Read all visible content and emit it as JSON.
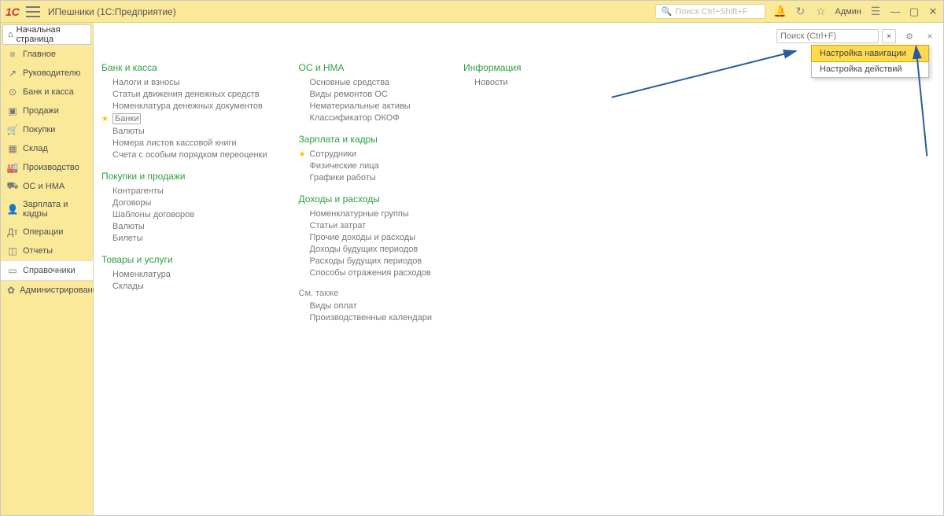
{
  "titlebar": {
    "app_title": "ИПешники  (1С:Предприятие)",
    "search_placeholder": "Поиск Ctrl+Shift+F",
    "user_label": "Админ"
  },
  "home_tab": {
    "label": "Начальная страница"
  },
  "sidebar": {
    "items": [
      {
        "icon": "≡",
        "label": "Главное"
      },
      {
        "icon": "↗",
        "label": "Руководителю"
      },
      {
        "icon": "⊙",
        "label": "Банк и касса"
      },
      {
        "icon": "▣",
        "label": "Продажи"
      },
      {
        "icon": "🛒",
        "label": "Покупки"
      },
      {
        "icon": "▦",
        "label": "Склад"
      },
      {
        "icon": "🏭",
        "label": "Производство"
      },
      {
        "icon": "⛟",
        "label": "ОС и НМА"
      },
      {
        "icon": "👤",
        "label": "Зарплата и кадры"
      },
      {
        "icon": "Дт",
        "label": "Операции"
      },
      {
        "icon": "◫",
        "label": "Отчеты"
      },
      {
        "icon": "▭",
        "label": "Справочники"
      },
      {
        "icon": "✿",
        "label": "Администрирование"
      }
    ],
    "selected_index": 11
  },
  "panel": {
    "search_placeholder": "Поиск (Ctrl+F)",
    "dropdown": {
      "items": [
        "Настройка навигации",
        "Настройка действий"
      ],
      "highlighted_index": 0
    }
  },
  "columns": [
    {
      "groups": [
        {
          "title": "Банк и касса",
          "links": [
            {
              "text": "Налоги и взносы"
            },
            {
              "text": "Статьи движения денежных средств"
            },
            {
              "text": "Номенклатура денежных документов"
            },
            {
              "text": "Банки",
              "starred": true,
              "boxed": true
            },
            {
              "text": "Валюты"
            },
            {
              "text": "Номера листов кассовой книги"
            },
            {
              "text": "Счета с особым порядком переоценки"
            }
          ]
        },
        {
          "title": "Покупки и продажи",
          "links": [
            {
              "text": "Контрагенты"
            },
            {
              "text": "Договоры"
            },
            {
              "text": "Шаблоны договоров"
            },
            {
              "text": "Валюты"
            },
            {
              "text": "Билеты"
            }
          ]
        },
        {
          "title": "Товары и услуги",
          "links": [
            {
              "text": "Номенклатура"
            },
            {
              "text": "Склады"
            }
          ]
        }
      ]
    },
    {
      "groups": [
        {
          "title": "ОС и НМА",
          "links": [
            {
              "text": "Основные средства"
            },
            {
              "text": "Виды ремонтов ОС"
            },
            {
              "text": "Нематериальные активы"
            },
            {
              "text": "Классификатор ОКОФ"
            }
          ]
        },
        {
          "title": "Зарплата и кадры",
          "links": [
            {
              "text": "Сотрудники",
              "starred": true
            },
            {
              "text": "Физические лица"
            },
            {
              "text": "Графики работы"
            }
          ]
        },
        {
          "title": "Доходы и расходы",
          "links": [
            {
              "text": "Номенклатурные группы"
            },
            {
              "text": "Статьи затрат"
            },
            {
              "text": "Прочие доходы и расходы"
            },
            {
              "text": "Доходы будущих периодов"
            },
            {
              "text": "Расходы будущих периодов"
            },
            {
              "text": "Способы отражения расходов"
            }
          ]
        }
      ],
      "see_also": {
        "label": "См. также",
        "links": [
          {
            "text": "Виды оплат"
          },
          {
            "text": "Производственные календари"
          }
        ]
      }
    },
    {
      "groups": [
        {
          "title": "Информация",
          "links": [
            {
              "text": "Новости"
            }
          ]
        }
      ]
    }
  ]
}
